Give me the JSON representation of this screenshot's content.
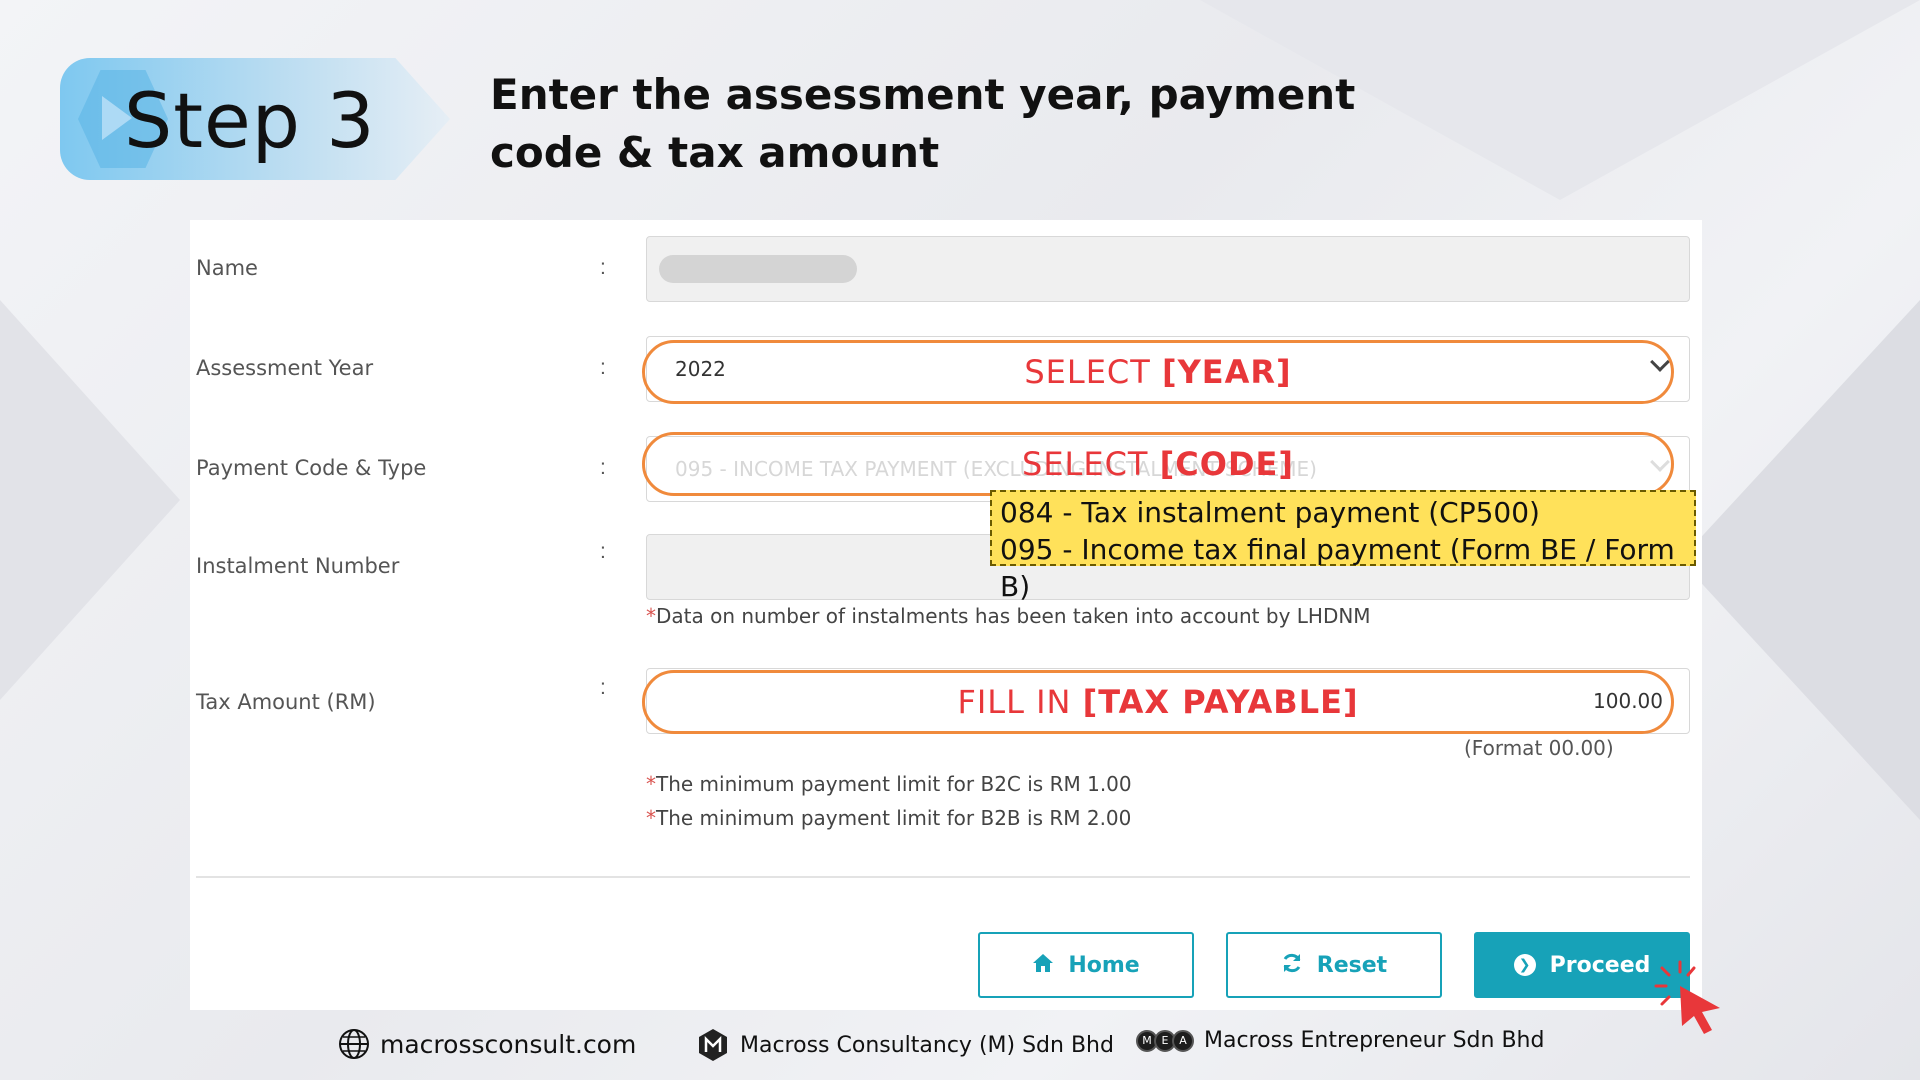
{
  "header": {
    "step_label": "Step 3",
    "instruction": "Enter the assessment year, payment code & tax amount"
  },
  "form": {
    "name": {
      "label": "Name",
      "colon": ":"
    },
    "assessment_year": {
      "label": "Assessment Year",
      "colon": ":",
      "value": "2022"
    },
    "payment_code": {
      "label": "Payment Code & Type",
      "colon": ":",
      "value": "095 - INCOME TAX PAYMENT (EXCLUDING INSTALMENT SCHEME)"
    },
    "instalment_number": {
      "label": "Instalment Number",
      "colon": ":",
      "note_star": "*",
      "note": "Data on number of instalments has been taken into account by LHDNM"
    },
    "tax_amount": {
      "label": "Tax Amount (RM)",
      "colon": ":",
      "value": "100.00",
      "format_hint": "(Format 00.00)",
      "note1_star": "*",
      "note1": "The minimum payment limit for B2C is RM 1.00",
      "note2_star": "*",
      "note2": "The minimum payment limit for B2B is RM 2.00"
    }
  },
  "buttons": {
    "home": "Home",
    "reset": "Reset",
    "proceed": "Proceed"
  },
  "annotations": {
    "select_year_prefix": "SELECT ",
    "select_year_bold": "[YEAR]",
    "select_code_prefix": "SELECT ",
    "select_code_bold": "[CODE]",
    "fill_prefix": "FILL IN ",
    "fill_bold": "[TAX PAYABLE]",
    "code_options": [
      "084 - Tax instalment payment (CP500)",
      "095 - Income tax final payment (Form BE / Form B)"
    ]
  },
  "footer": {
    "website": "macrossconsult.com",
    "company1": "Macross Consultancy (M) Sdn Bhd",
    "company2": "Macross Entrepreneur Sdn Bhd",
    "mea_letters": [
      "M",
      "E",
      "A"
    ]
  },
  "colors": {
    "accent": "#17a2b8",
    "highlight_border": "#f08a3c",
    "annotation_text": "#e8373a",
    "code_box_bg": "#ffe15a"
  },
  "icons": {
    "home": "home-icon",
    "reset": "refresh-icon",
    "proceed": "arrow-circle-right-icon",
    "web": "globe-icon"
  }
}
